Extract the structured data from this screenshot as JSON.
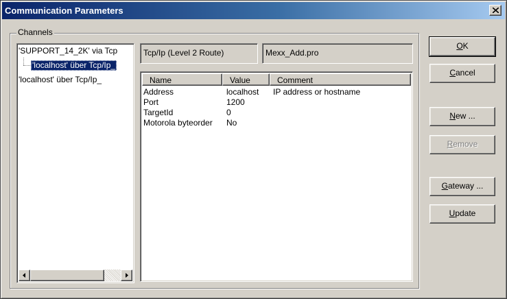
{
  "window": {
    "title": "Communication Parameters",
    "close_label": "close"
  },
  "channels": {
    "label": "Channels",
    "tree": [
      {
        "label": "'SUPPORT_14_2K' via Tcp"
      },
      {
        "label": "'localhost' über Tcp/Ip_"
      },
      {
        "label": "'localhost' über Tcp/Ip_"
      }
    ]
  },
  "connection": {
    "driver": "Tcp/Ip (Level 2 Route)",
    "project": "Mexx_Add.pro"
  },
  "parameters": {
    "columns": [
      "Name",
      "Value",
      "Comment"
    ],
    "rows": [
      {
        "name": "Address",
        "value": "localhost",
        "comment": "IP address or hostname"
      },
      {
        "name": "Port",
        "value": "1200",
        "comment": ""
      },
      {
        "name": "TargetId",
        "value": "0",
        "comment": ""
      },
      {
        "name": "Motorola byteorder",
        "value": "No",
        "comment": ""
      }
    ]
  },
  "buttons": {
    "ok": {
      "accel": "O",
      "rest": "K"
    },
    "cancel": {
      "accel": "C",
      "rest": "ancel"
    },
    "new": {
      "accel": "N",
      "rest": "ew ..."
    },
    "remove": {
      "accel": "R",
      "rest": "emove"
    },
    "gateway": {
      "accel": "G",
      "rest": "ateway ..."
    },
    "update": {
      "accel": "U",
      "rest": "pdate"
    }
  },
  "colors": {
    "face": "#d4d0c8",
    "selection": "#0a246a",
    "title_start": "#0a246a",
    "title_end": "#a6caf0"
  }
}
